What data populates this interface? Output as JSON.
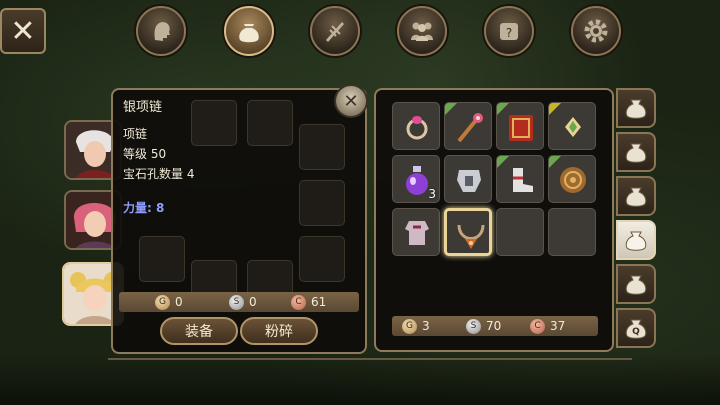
{
  "top_tabs": [
    {
      "icon": "character-head-icon",
      "active": false
    },
    {
      "icon": "bag-icon",
      "active": true
    },
    {
      "icon": "skills-blade-icon",
      "active": false
    },
    {
      "icon": "party-icon",
      "active": false
    },
    {
      "icon": "quest-scroll-icon",
      "active": false
    },
    {
      "icon": "gear-icon",
      "active": false
    }
  ],
  "tooltip": {
    "item_name": "银项链",
    "item_type": "项链",
    "level": "等级 50",
    "gem_sockets": "宝石孔数量 4",
    "attribute": "力量: 8"
  },
  "left_currency": {
    "gold": "0",
    "silver": "0",
    "copper": "61"
  },
  "buttons": {
    "equip": "装备",
    "smash": "粉碎"
  },
  "inventory": {
    "slots": [
      {
        "icon": "ring-icon",
        "corner": "",
        "qty": ""
      },
      {
        "icon": "staff-icon",
        "corner": "#6aa84f",
        "qty": ""
      },
      {
        "icon": "spellbook-icon",
        "corner": "#6aa84f",
        "qty": ""
      },
      {
        "icon": "amulet-gem-icon",
        "corner": "#c9b32a",
        "qty": ""
      },
      {
        "icon": "potion-icon",
        "corner": "",
        "qty": "3"
      },
      {
        "icon": "chest-armor-icon",
        "corner": "",
        "qty": ""
      },
      {
        "icon": "boots-icon",
        "corner": "#6aa84f",
        "qty": ""
      },
      {
        "icon": "shield-icon",
        "corner": "#6aa84f",
        "qty": ""
      },
      {
        "icon": "robe-armor-icon",
        "corner": "",
        "qty": ""
      },
      {
        "icon": "necklace-icon",
        "corner": "",
        "qty": "",
        "selected": true
      },
      {
        "icon": "",
        "corner": "",
        "qty": ""
      },
      {
        "icon": "",
        "corner": "",
        "qty": ""
      }
    ]
  },
  "right_currency": {
    "gold": "3",
    "silver": "70",
    "copper": "37"
  },
  "bag_tabs": [
    {
      "icon": "bag-icon",
      "label": "",
      "active": false
    },
    {
      "icon": "bag-icon",
      "label": "",
      "active": false
    },
    {
      "icon": "bag-icon",
      "label": "",
      "active": false
    },
    {
      "icon": "bag-icon",
      "label": "",
      "active": true
    },
    {
      "icon": "bag-icon",
      "label": "",
      "active": false
    },
    {
      "icon": "quest-bag-icon",
      "label": "Q",
      "active": false
    }
  ],
  "colors": {
    "frame": "#8e7b5a",
    "attribute_text": "#8f9dff",
    "rare_corner": "#6aa84f",
    "epic_corner": "#c9b32a"
  }
}
